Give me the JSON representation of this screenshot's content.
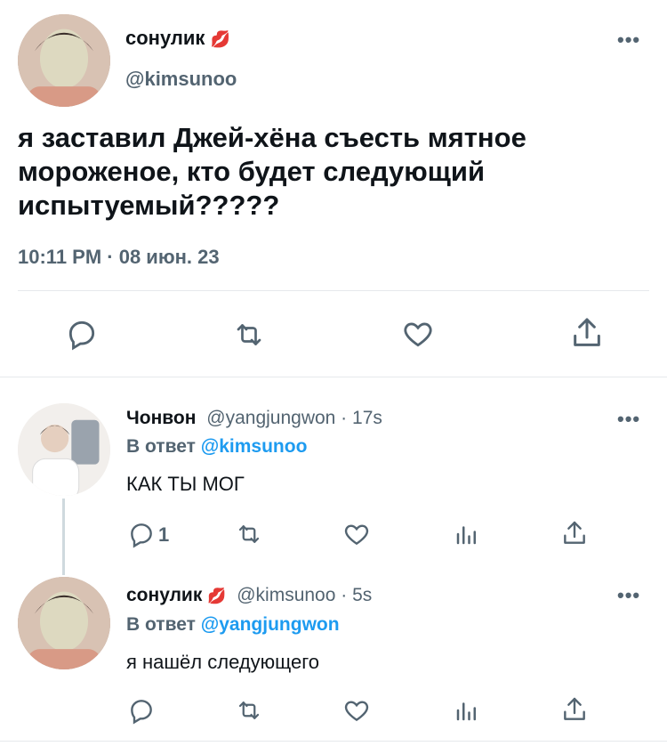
{
  "main_tweet": {
    "display_name": "сонулик",
    "name_emoji": "💋",
    "handle": "@kimsunoo",
    "text": "я заставил Джей-хёна съесть мятное мороженое, кто будет следующий испытуемый?????",
    "timestamp": "10:11 PM · 08 июн. 23",
    "more_icon": "more-horizontal-icon",
    "actions": [
      "reply-icon",
      "retweet-icon",
      "like-icon",
      "share-icon"
    ]
  },
  "reply1": {
    "display_name": "Чонвон",
    "meta": "@yangjungwon · 17s",
    "reply_prefix": "В ответ",
    "reply_mention": "@kimsunoo",
    "text": "КАК ТЫ МОГ",
    "reply_count": "1"
  },
  "reply2": {
    "display_name": "сонулик",
    "name_emoji": "💋",
    "meta": "@kimsunoo · 5s",
    "reply_prefix": "В ответ",
    "reply_mention": "@yangjungwon",
    "text": "я нашёл следующего"
  },
  "colors": {
    "accent": "#1d9bf0",
    "muted": "#536471",
    "divider": "#e6e9ec",
    "emoji": "#e0245e"
  }
}
